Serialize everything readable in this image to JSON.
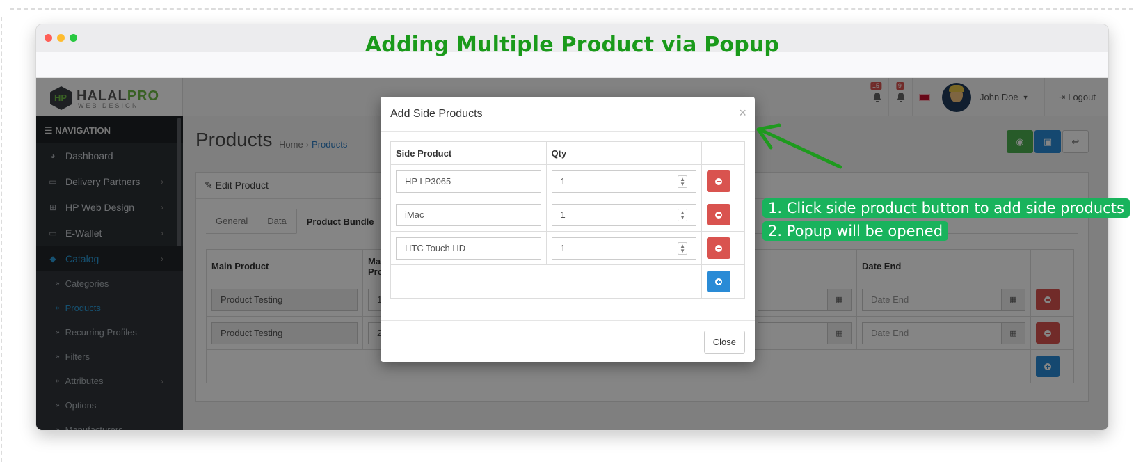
{
  "window": {
    "title": "Adding Multiple Product via Popup"
  },
  "logo": {
    "name_a": "HALAL",
    "name_b": "PRO",
    "sub": "WEB DESIGN"
  },
  "header": {
    "notif_count_1": "15",
    "notif_count_2": "9",
    "user_name": "John Doe",
    "logout": "Logout"
  },
  "sidebar": {
    "heading": "NAVIGATION",
    "items": [
      {
        "label": "Dashboard",
        "icon": "dashboard-icon"
      },
      {
        "label": "Delivery Partners",
        "icon": "card-icon"
      },
      {
        "label": "HP Web Design",
        "icon": "windows-icon"
      },
      {
        "label": "E-Wallet",
        "icon": "card-icon"
      },
      {
        "label": "Catalog",
        "icon": "tag-icon"
      }
    ],
    "sub_items": [
      "Categories",
      "Products",
      "Recurring Profiles",
      "Filters",
      "Attributes",
      "Options",
      "Manufacturers"
    ]
  },
  "page": {
    "title": "Products",
    "crumb_home": "Home",
    "crumb_current": "Products"
  },
  "panel": {
    "heading": "Edit Product",
    "tabs": [
      "General",
      "Data",
      "Product Bundle"
    ],
    "columns": {
      "main_product": "Main Product",
      "ma": "Ma",
      "pro": "Pro",
      "date_end": "Date End"
    },
    "rows": [
      {
        "main_product": "Product Testing",
        "col2": "1",
        "date_end_placeholder": "Date End"
      },
      {
        "main_product": "Product Testing",
        "col2": "2",
        "date_end_placeholder": "Date End"
      }
    ]
  },
  "modal": {
    "title": "Add Side Products",
    "close_x": "×",
    "col_side_product": "Side Product",
    "col_qty": "Qty",
    "rows": [
      {
        "product": "HP LP3065",
        "qty": "1"
      },
      {
        "product": "iMac",
        "qty": "1"
      },
      {
        "product": "HTC Touch HD",
        "qty": "1"
      }
    ],
    "close_label": "Close"
  },
  "annotations": {
    "line1": "1. Click side product button to add side products",
    "line2": "2. Popup will be opened",
    "color": "#19b35c"
  }
}
